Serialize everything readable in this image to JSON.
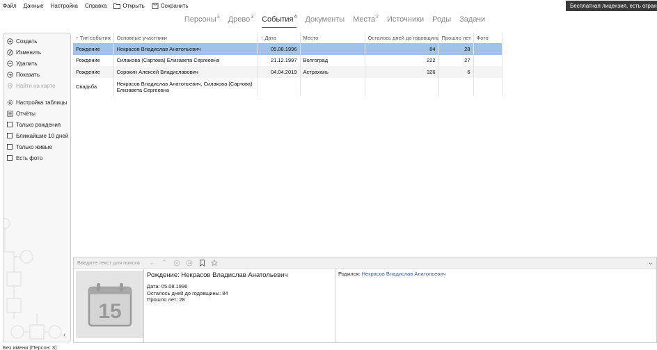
{
  "menu": {
    "file": "Файл",
    "data": "Данные",
    "settings": "Настройка",
    "help": "Справка",
    "open": "Открыть",
    "save": "Сохранить"
  },
  "license": "Бесплатная лицензия, есть ограничения",
  "tabs": [
    {
      "label": "Персоны",
      "count": "3"
    },
    {
      "label": "Древо",
      "count": "3"
    },
    {
      "label": "События",
      "count": "4"
    },
    {
      "label": "Документы",
      "count": ""
    },
    {
      "label": "Места",
      "count": "2"
    },
    {
      "label": "Источники",
      "count": ""
    },
    {
      "label": "Роды",
      "count": ""
    },
    {
      "label": "Задачи",
      "count": ""
    }
  ],
  "sidebar": {
    "create": "Создать",
    "edit": "Изменить",
    "delete": "Удалить",
    "show": "Показать",
    "find_on_map": "Найти на карте",
    "table_settings": "Настройка таблицы",
    "reports": "Отчёты",
    "only_births": "Только рождения",
    "nearest_10_days": "Ближайшие 10 дней",
    "only_alive": "Только живые",
    "has_photo": "Есть фото"
  },
  "table": {
    "columns": {
      "event_type": "↑ Тип события",
      "participants": "Основные участники",
      "date": "↑ Дата",
      "place": "Место",
      "days_left": "Осталось дней до годовщины",
      "years_passed": "Прошло лет",
      "photo": "Фото"
    },
    "rows": [
      {
        "type": "Рождение",
        "participants": "Некрасов Владислав Анатольевич",
        "date": "05.08.1996",
        "place": "",
        "days": "84",
        "years": "28",
        "photo": ""
      },
      {
        "type": "Рождение",
        "participants": "Силакова (Сартова) Елизавета Сергеевна",
        "date": "21.12.1997",
        "place": "Волгоград",
        "days": "222",
        "years": "27",
        "photo": ""
      },
      {
        "type": "Рождение",
        "participants": "Сорокин Алексей Владиславович",
        "date": "04.04.2019",
        "place": "Астрахань",
        "days": "326",
        "years": "6",
        "photo": ""
      },
      {
        "type": "Свадьба",
        "participants": "Некрасов Владислав Анатольевич, Силакова (Сартова) Елизавета Сергеевна",
        "date": "",
        "place": "",
        "days": "",
        "years": "",
        "photo": ""
      }
    ]
  },
  "bottom": {
    "search_placeholder": "Введите текст для поиска",
    "calendar_day": "15",
    "title": "Рождение: Некрасов Владислав Анатольевич",
    "date_line": "Дата: 05.08.1996",
    "days_line": "Осталось дней до годовщины: 84",
    "years_line": "Прошло лет: 28",
    "born_label": "Родился:",
    "born_link": "Некрасов Владислав Анатольевич"
  },
  "status": "Без имени (Персон: 3)",
  "colors": {
    "selected_row": "#9fc3e9",
    "link": "#2a5bd0",
    "license_bg": "#3a3a3a"
  }
}
